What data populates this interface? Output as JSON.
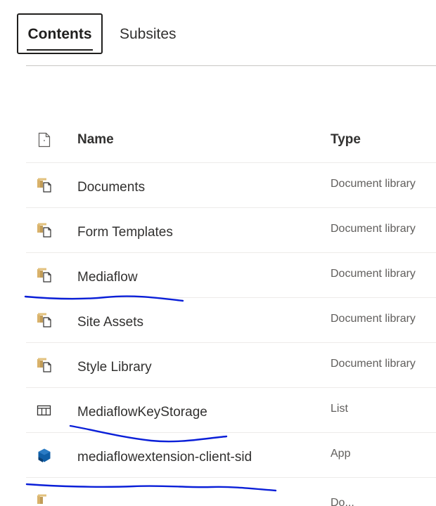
{
  "tabs": [
    {
      "label": "Contents",
      "selected": true
    },
    {
      "label": "Subsites",
      "selected": false
    }
  ],
  "table": {
    "columns": {
      "name": "Name",
      "type": "Type"
    },
    "rows": [
      {
        "name": "Documents",
        "type": "Document library",
        "icon": "document-library-icon"
      },
      {
        "name": "Form Templates",
        "type": "Document library",
        "icon": "document-library-icon"
      },
      {
        "name": "Mediaflow",
        "type": "Document library",
        "icon": "document-library-icon"
      },
      {
        "name": "Site Assets",
        "type": "Document library",
        "icon": "document-library-icon"
      },
      {
        "name": "Style Library",
        "type": "Document library",
        "icon": "document-library-icon"
      },
      {
        "name": "MediaflowKeyStorage",
        "type": "List",
        "icon": "list-icon"
      },
      {
        "name": "mediaflowextension-client-sid",
        "type": "App",
        "icon": "app-icon"
      }
    ],
    "partial_row": {
      "type": "Do...",
      "icon": "document-library-icon"
    }
  },
  "colors": {
    "library_icon": "#c19c58",
    "app_icon": "#0f5ea6",
    "annotation": "#0a1fd8",
    "divider": "#edebe9"
  }
}
